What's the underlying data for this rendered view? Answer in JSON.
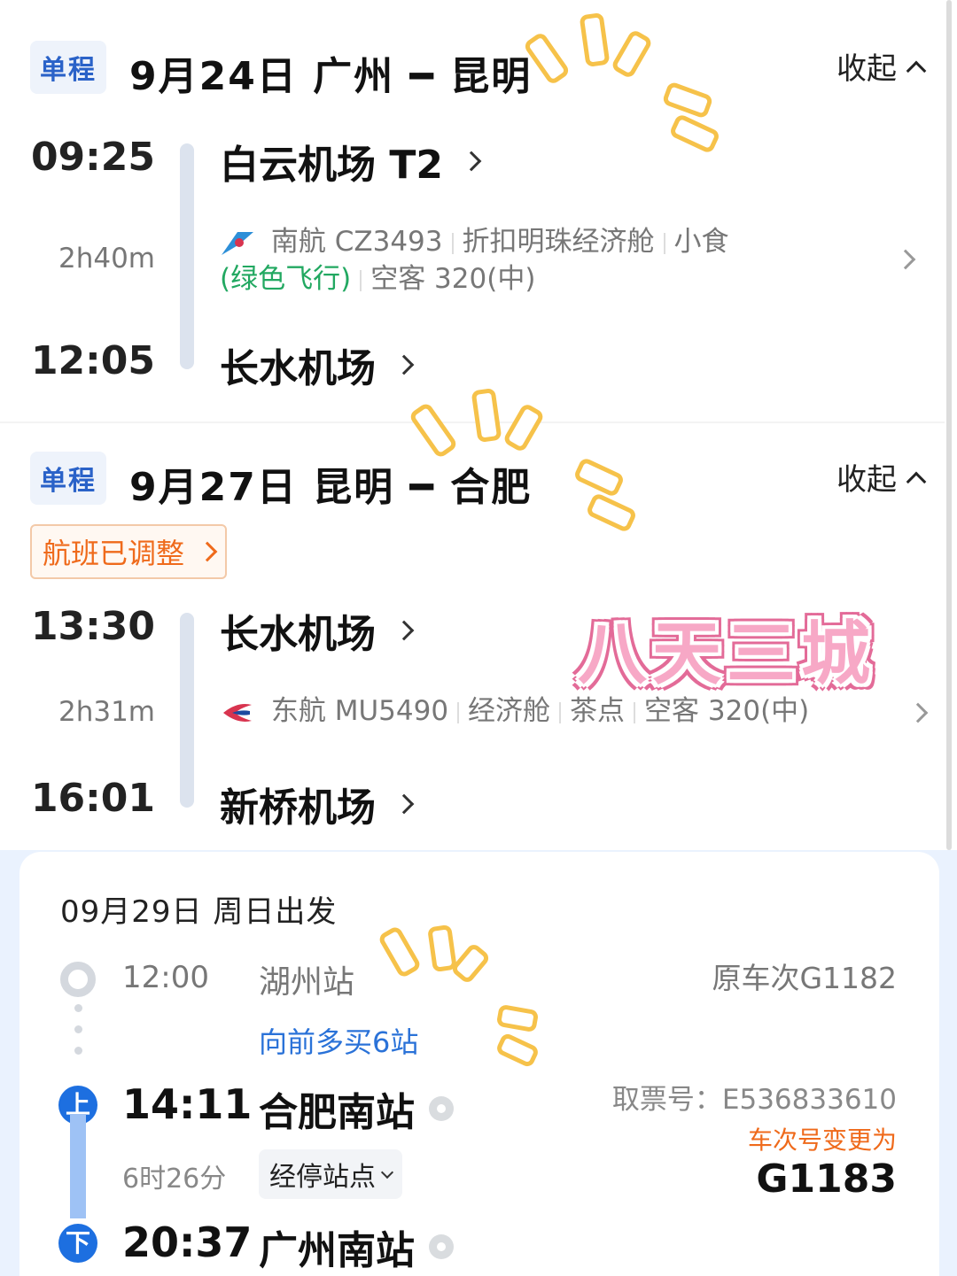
{
  "flights": [
    {
      "tag": "单程",
      "route": "9月24日 广州 ━ 昆明",
      "collapse_label": "收起",
      "dep_time": "09:25",
      "duration": "2h40m",
      "arr_time": "12:05",
      "dep_airport": "白云机场 T2",
      "arr_airport": "长水机场",
      "airline_logo": "china-southern-logo",
      "detail_line1": [
        "南航 CZ3493",
        "折扣明珠经济舱",
        "小食"
      ],
      "detail_line2_green": "(绿色飞行)",
      "detail_line2": "空客 320(中)"
    },
    {
      "tag": "单程",
      "route": "9月27日 昆明 ━ 合肥",
      "collapse_label": "收起",
      "adjust_label": "航班已调整",
      "dep_time": "13:30",
      "duration": "2h31m",
      "arr_time": "16:01",
      "dep_airport": "长水机场",
      "arr_airport": "新桥机场",
      "airline_logo": "china-eastern-logo",
      "detail_line1": [
        "东航 MU5490",
        "经济舱",
        "茶点",
        "空客 320(中)"
      ]
    }
  ],
  "sticker_text": "八天三城",
  "train": {
    "date": "09月29日 周日出发",
    "origin_time": "12:00",
    "origin_station": "湖州站",
    "original_train": "原车次G1182",
    "buy_ahead": "向前多买6站",
    "board_badge": "上",
    "board_time": "14:11",
    "board_station": "合肥南站",
    "duration": "6时26分",
    "stops_button": "经停站点",
    "alight_badge": "下",
    "alight_time": "20:37",
    "alight_station": "广州南站",
    "ticket_no": "取票号：E536833610",
    "changed_note": "车次号变更为",
    "new_train": "G1183"
  },
  "colors": {
    "accent_blue": "#1d6fe0",
    "orange": "#ef6a1b",
    "green": "#22a861",
    "sticker_pink": "#f7a8c6",
    "doodle_yellow": "#f6c24a"
  }
}
